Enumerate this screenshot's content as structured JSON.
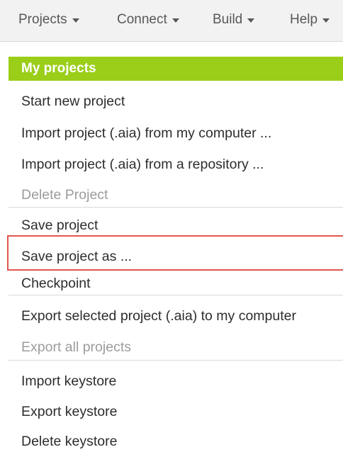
{
  "menubar": {
    "items": [
      {
        "label": "Projects",
        "icon": "chevron-down-icon"
      },
      {
        "label": "Connect",
        "icon": "chevron-down-icon"
      },
      {
        "label": "Build",
        "icon": "chevron-down-icon"
      },
      {
        "label": "Help",
        "icon": "chevron-down-icon"
      }
    ]
  },
  "menu": {
    "header": "My projects",
    "groups": [
      [
        {
          "label": "Start new project",
          "enabled": true
        },
        {
          "label": "Import project (.aia) from my computer ...",
          "enabled": true
        },
        {
          "label": "Import project (.aia) from a repository ...",
          "enabled": true
        },
        {
          "label": "Delete Project",
          "enabled": false
        }
      ],
      [
        {
          "label": "Save project",
          "enabled": true
        },
        {
          "label": "Save project as ...",
          "enabled": true
        },
        {
          "label": "Checkpoint",
          "enabled": true
        }
      ],
      [
        {
          "label": "Export selected project (.aia) to my computer",
          "enabled": true,
          "highlighted": true
        },
        {
          "label": "Export all projects",
          "enabled": false
        }
      ],
      [
        {
          "label": "Import keystore",
          "enabled": true
        },
        {
          "label": "Export keystore",
          "enabled": true
        },
        {
          "label": "Delete keystore",
          "enabled": true
        }
      ]
    ]
  },
  "colors": {
    "header_bg": "#9ace19",
    "highlight_border": "#e0564e",
    "disabled_text": "#9c9c9c"
  }
}
